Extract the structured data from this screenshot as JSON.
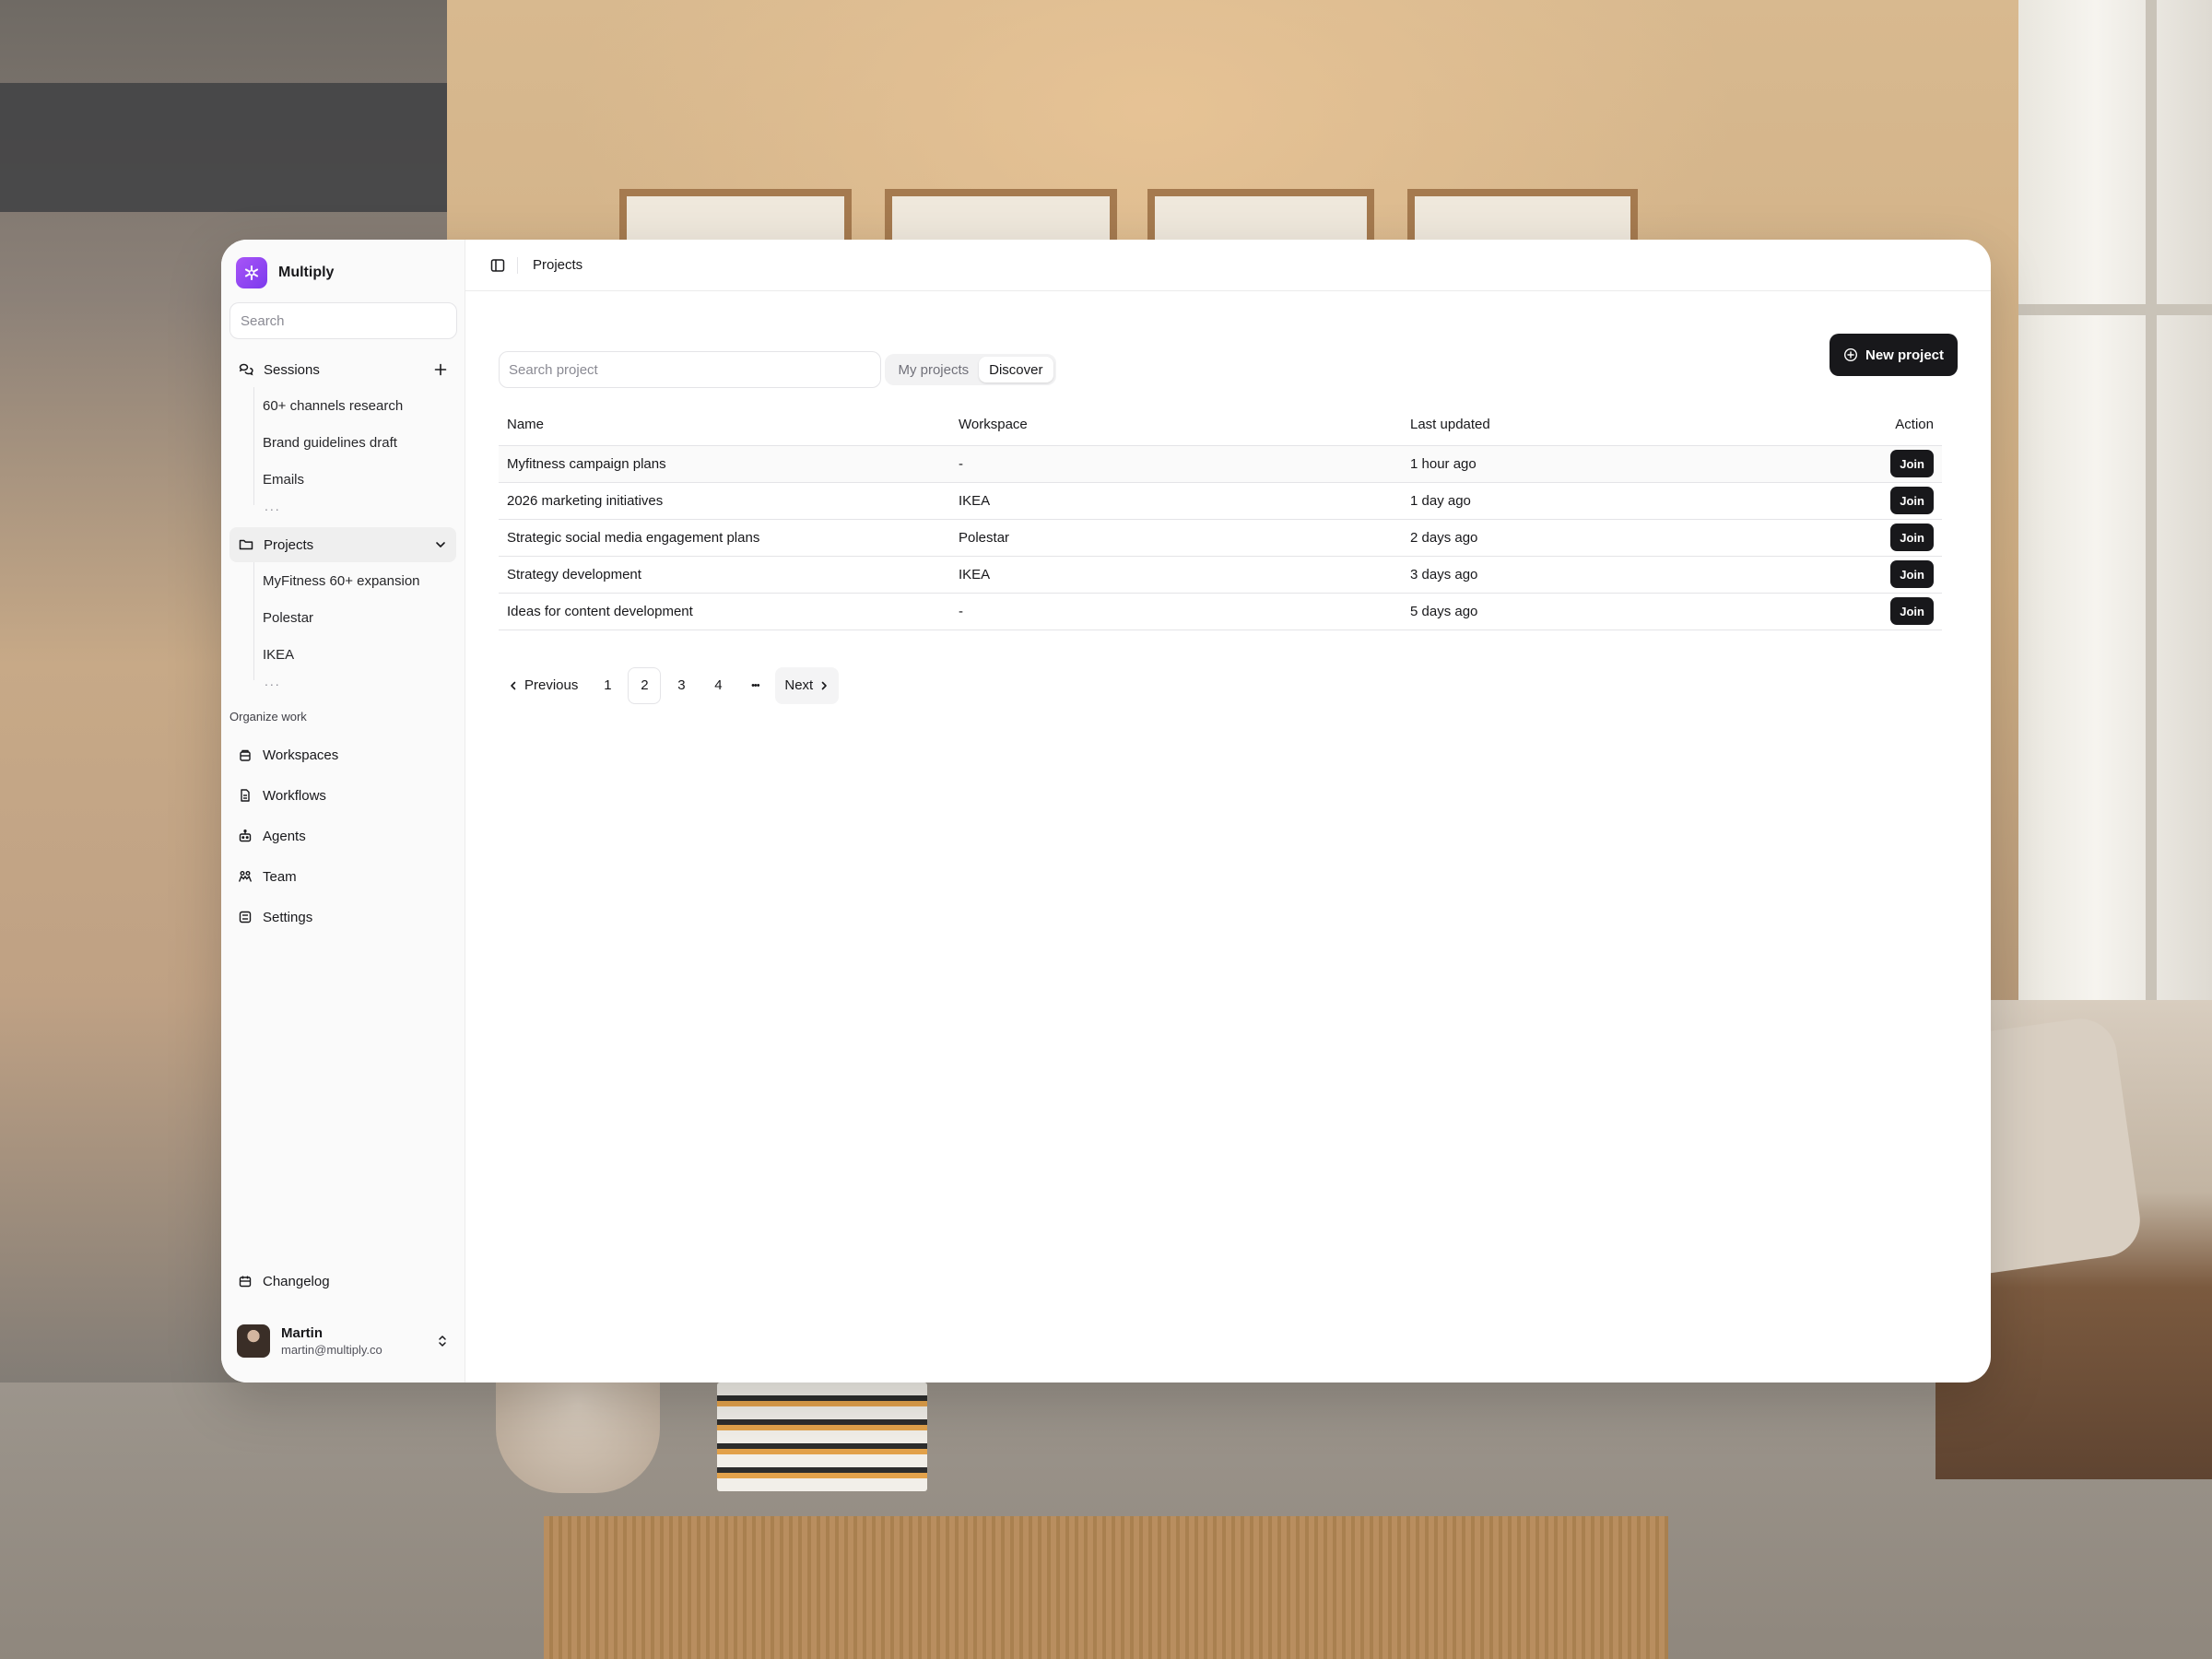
{
  "app": {
    "name": "Multiply"
  },
  "sidebar": {
    "search_placeholder": "Search",
    "sessions": {
      "label": "Sessions",
      "items": [
        "60+ channels research",
        "Brand guidelines draft",
        "Emails"
      ],
      "more": "..."
    },
    "projects": {
      "label": "Projects",
      "items": [
        "MyFitness 60+ expansion",
        "Polestar",
        "IKEA"
      ],
      "more": "..."
    },
    "section_label": "Organize work",
    "nav": [
      {
        "label": "Workspaces",
        "icon": "workspaces-icon"
      },
      {
        "label": "Workflows",
        "icon": "workflows-icon"
      },
      {
        "label": "Agents",
        "icon": "agents-icon"
      },
      {
        "label": "Team",
        "icon": "team-icon"
      },
      {
        "label": "Settings",
        "icon": "settings-icon"
      }
    ],
    "changelog": "Changelog",
    "user": {
      "name": "Martin",
      "email": "martin@multiply.co"
    }
  },
  "topbar": {
    "breadcrumb": "Projects"
  },
  "main": {
    "search_placeholder": "Search project",
    "new_project_label": "New project",
    "tabs": [
      {
        "label": "My projects",
        "active": false
      },
      {
        "label": "Discover",
        "active": true
      }
    ],
    "table": {
      "headers": {
        "name": "Name",
        "workspace": "Workspace",
        "updated": "Last updated",
        "action": "Action"
      },
      "rows": [
        {
          "name": "Myfitness campaign plans",
          "workspace": "-",
          "updated": "1 hour ago",
          "action": "Join"
        },
        {
          "name": "2026 marketing initiatives",
          "workspace": "IKEA",
          "updated": "1 day ago",
          "action": "Join"
        },
        {
          "name": "Strategic social media engagement plans",
          "workspace": "Polestar",
          "updated": "2 days ago",
          "action": "Join"
        },
        {
          "name": "Strategy development",
          "workspace": "IKEA",
          "updated": "3 days ago",
          "action": "Join"
        },
        {
          "name": "Ideas for content development",
          "workspace": "-",
          "updated": "5 days ago",
          "action": "Join"
        }
      ]
    },
    "pagination": {
      "previous": "Previous",
      "pages": [
        "1",
        "2",
        "3",
        "4"
      ],
      "current": "2",
      "ellipsis": "•••",
      "next": "Next"
    }
  },
  "colors": {
    "brand": "#8b5cf6",
    "primary_button": "#18181b"
  }
}
